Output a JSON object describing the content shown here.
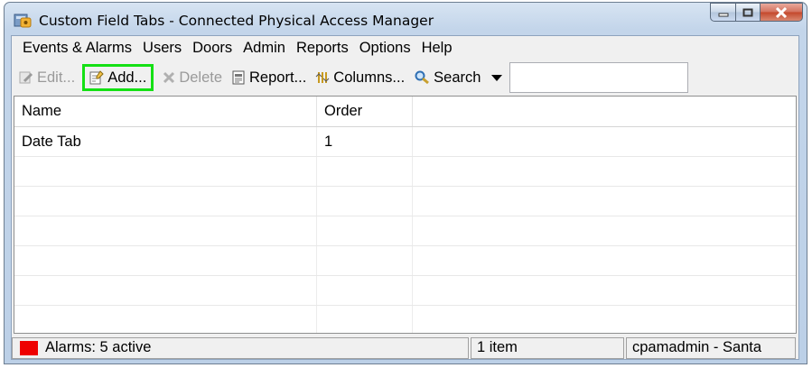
{
  "window": {
    "title": "Custom Field Tabs - Connected Physical Access Manager"
  },
  "menu": [
    "Events & Alarms",
    "Users",
    "Doors",
    "Admin",
    "Reports",
    "Options",
    "Help"
  ],
  "toolbar": {
    "edit_label": "Edit...",
    "add_label": "Add...",
    "delete_label": "Delete",
    "report_label": "Report...",
    "columns_label": "Columns...",
    "search_label": "Search",
    "search_value": ""
  },
  "table": {
    "columns": [
      "Name",
      "Order"
    ],
    "rows": [
      {
        "name": "Date Tab",
        "order": "1"
      }
    ]
  },
  "status": {
    "alarms": "Alarms: 5 active",
    "count": "1 item",
    "user": "cpamadmin - Santa"
  },
  "colors": {
    "highlight": "#14e014",
    "alarm": "#ee0000"
  }
}
